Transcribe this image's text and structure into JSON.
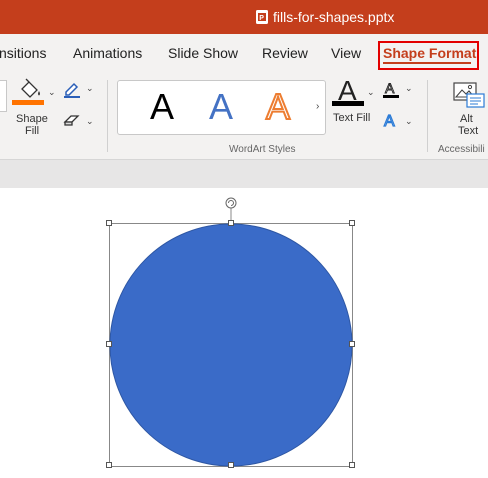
{
  "window": {
    "document_title": "fills-for-shapes.pptx"
  },
  "tabs": [
    {
      "label": "nsitions"
    },
    {
      "label": "Animations"
    },
    {
      "label": "Slide Show"
    },
    {
      "label": "Review"
    },
    {
      "label": "View"
    },
    {
      "label": "Shape Format",
      "active": true
    }
  ],
  "ribbon": {
    "shape_fill_label_line1": "Shape",
    "shape_fill_label_line2": "Fill",
    "wordart_group_label": "WordArt Styles",
    "wordart_samples": [
      "A",
      "A",
      "A"
    ],
    "text_fill_glyph": "A",
    "text_fill_label": "Text Fill",
    "alt_text_label_line1": "Alt",
    "alt_text_label_line2": "Text",
    "accessibility_group_label": "Accessibili"
  },
  "colors": {
    "title_bar": "#c43e1c",
    "highlight_box": "#e30000",
    "shape_fill_swatch": "#ff7300",
    "shape": "#3a6bc8",
    "wordart_blue": "#4472c4",
    "wordart_orange": "#ed7d31"
  },
  "canvas": {
    "shape": "circle",
    "selected": true
  }
}
